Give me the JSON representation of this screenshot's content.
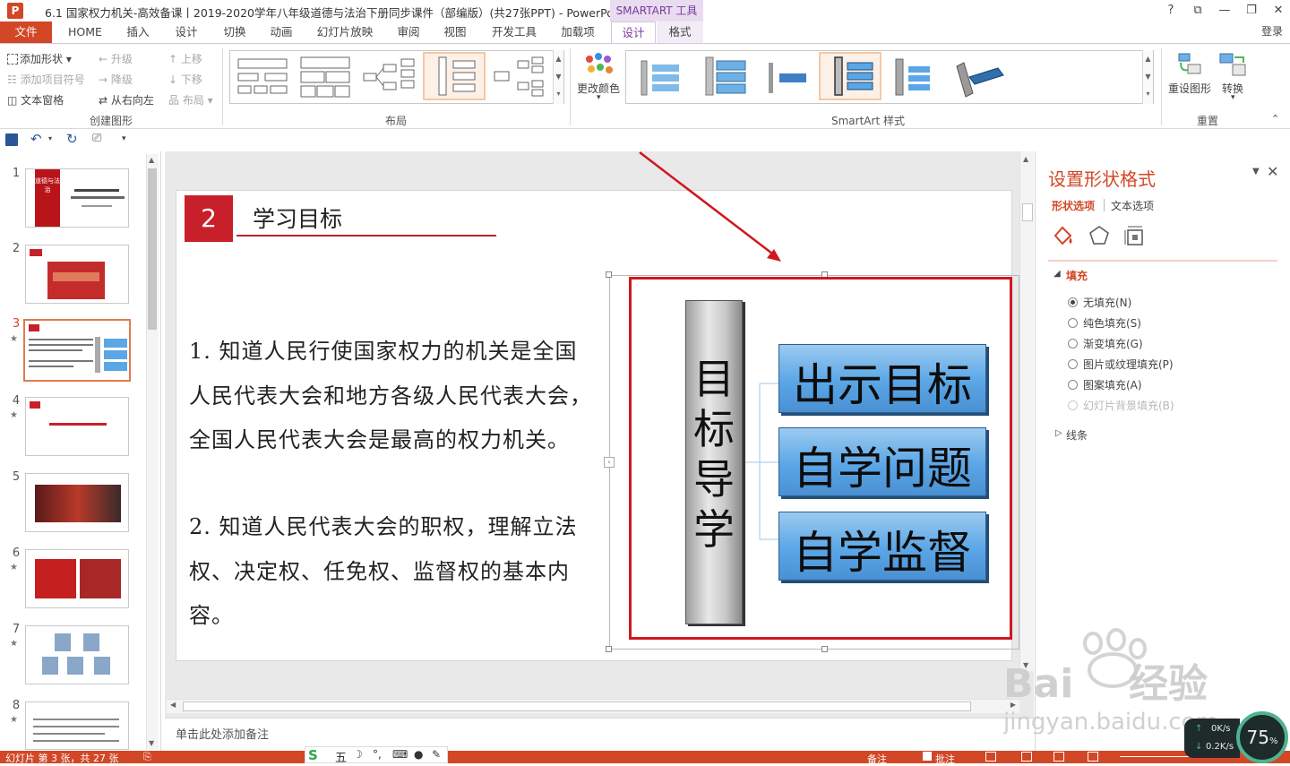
{
  "window": {
    "title": "6.1 国家权力机关-高效备课丨2019-2020学年八年级道德与法治下册同步课件（部编版）(共27张PPT) - PowerPoint",
    "context_tab_header": "SMARTART 工具",
    "controls": [
      "?",
      "⧉",
      "—",
      "❐",
      "✕"
    ]
  },
  "ribbon": {
    "file_tab": "文件",
    "tabs": [
      "HOME",
      "插入",
      "设计",
      "切换",
      "动画",
      "幻灯片放映",
      "审阅",
      "视图",
      "开发工具",
      "加载项"
    ],
    "context_tabs": [
      "设计",
      "格式"
    ],
    "login": "登录",
    "create_graphic": {
      "items": [
        "添加形状",
        "添加项目符号",
        "文本窗格",
        "升级",
        "降级",
        "从右向左",
        "上移",
        "下移",
        "布局"
      ],
      "label": "创建图形"
    },
    "layout_label": "布局",
    "change_colors": "更改颜色",
    "styles_label": "SmartArt 样式",
    "reset": {
      "items": [
        "重设图形",
        "转换"
      ],
      "label": "重置"
    }
  },
  "slides": {
    "numbers": [
      "1",
      "2",
      "3",
      "4",
      "5",
      "6",
      "7",
      "8"
    ],
    "selected": "3",
    "thumb1_title": "道德与法治"
  },
  "slide": {
    "badge": "2",
    "heading": "学习目标",
    "lines": [
      "1. 知道人民行使国家权力的机关是全国",
      "人民代表大会和地方各级人民代表大会，",
      "全国人民代表大会是最高的权力机关。",
      "2. 知道人民代表大会的职权，理解立法",
      "权、决定权、任免权、监督权的基本内",
      "容。"
    ],
    "smartart": {
      "vertical": [
        "目",
        "标",
        "导",
        "学"
      ],
      "boxes": [
        "出示目标",
        "自学问题",
        "自学监督"
      ]
    }
  },
  "notes_placeholder": "单击此处添加备注",
  "task_pane": {
    "title": "设置形状格式",
    "tabs": [
      "形状选项",
      "文本选项"
    ],
    "fill_section": "填充",
    "fill_options": [
      "无填充(N)",
      "纯色填充(S)",
      "渐变填充(G)",
      "图片或纹理填充(P)",
      "图案填充(A)",
      "幻灯片背景填充(B)"
    ],
    "line_section": "线条"
  },
  "status": {
    "slide_info": "幻灯片 第 3 张，共 27 张",
    "notes": "备注",
    "comments": "批注",
    "ime": "五"
  },
  "overlay": {
    "zoom": "75",
    "zoom_unit": "%",
    "up_speed": "0K/s",
    "down_speed": "0.2K/s"
  },
  "colors": {
    "accent": "#d24726",
    "smartart_context": "#7a3a9a",
    "red_frame": "#d0171f",
    "box_blue": "#5aa6e6"
  }
}
